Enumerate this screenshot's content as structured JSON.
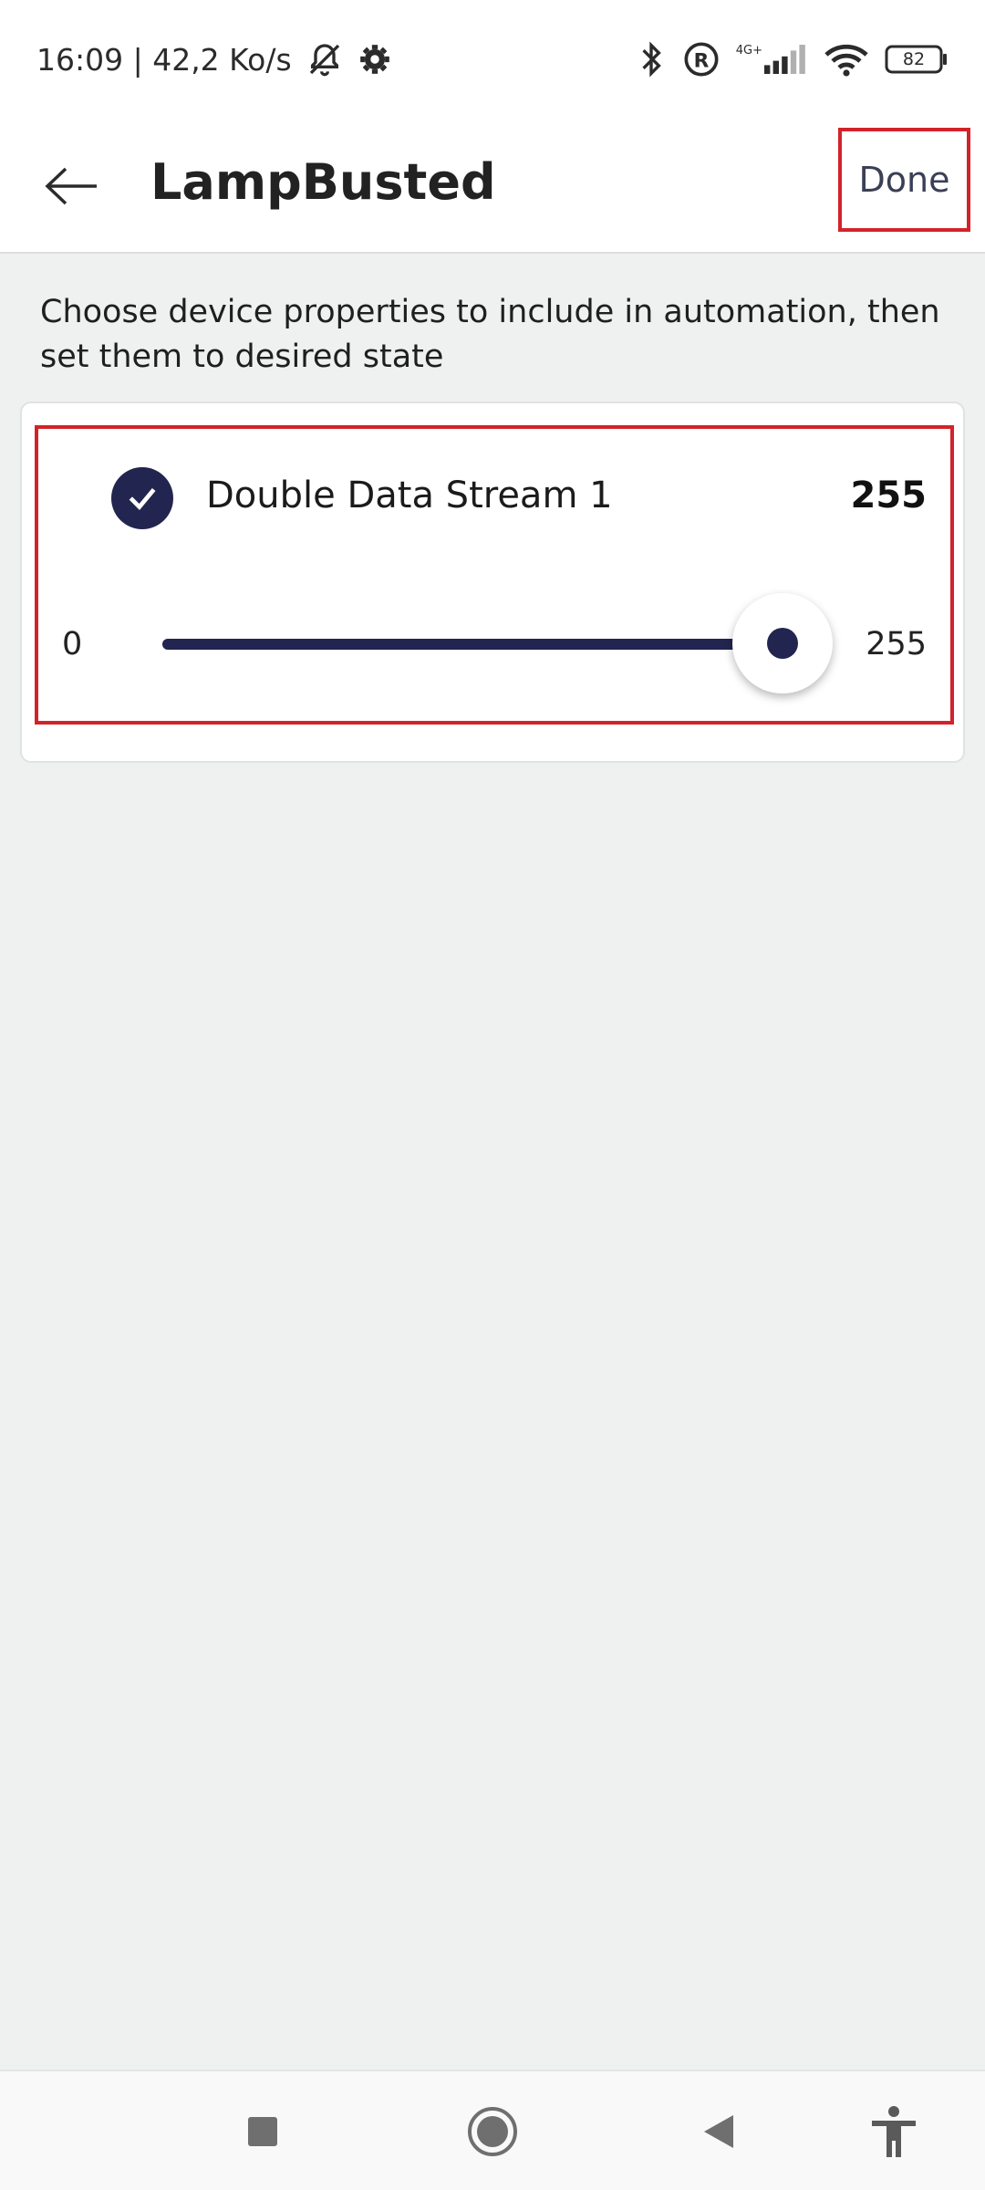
{
  "status_bar": {
    "time_speed": "16:09 | 42,2 Ko/s",
    "network": "4G+",
    "battery": "82",
    "icons": [
      "mute-icon",
      "settings-gear-icon",
      "bluetooth-icon",
      "roaming-icon",
      "signal-icon",
      "wifi-icon",
      "battery-icon"
    ]
  },
  "header": {
    "title": "LampBusted",
    "done_label": "Done",
    "back_icon": "arrow-left-icon"
  },
  "instructions": "Choose device properties to include in automation, then set them to desired state",
  "property": {
    "label": "Double Data Stream 1",
    "value": "255",
    "selected": true,
    "slider": {
      "min": "0",
      "max": "255",
      "current": 255,
      "fraction": 1.0
    }
  },
  "nav_bar": {
    "icons": [
      "recents-square-icon",
      "home-circle-icon",
      "back-triangle-icon",
      "accessibility-icon"
    ]
  },
  "colors": {
    "accent": "#22254f",
    "highlight": "#d2232a",
    "background": "#eef1f0"
  }
}
